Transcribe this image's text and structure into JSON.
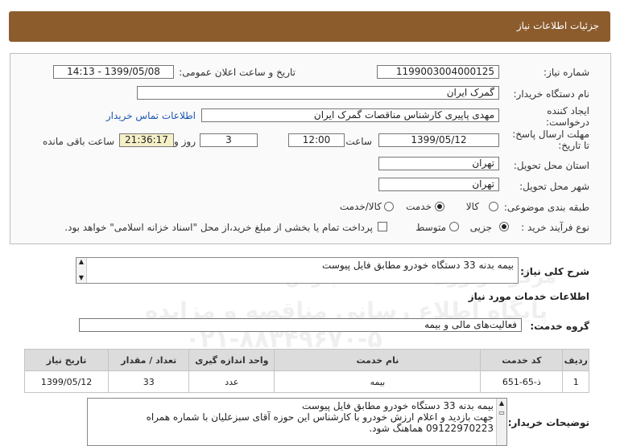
{
  "header": {
    "title": "جزئیات اطلاعات نیاز"
  },
  "fields": {
    "need_number_label": "شماره نیاز:",
    "need_number": "1199003004000125",
    "announce_label": "تاریخ و ساعت اعلان عمومی:",
    "announce_value": "1399/05/08 - 14:13",
    "buyer_org_label": "نام دستگاه خریدار:",
    "buyer_org": "گمرک ایران",
    "creator_label_1": "ایجاد کننده",
    "creator_label_2": "درخواست:",
    "creator": "مهدی پاپیری کارشناس مناقصات گمرک ایران",
    "contact_link": "اطلاعات تماس خریدار",
    "deadline_label_1": "مهلت ارسال پاسخ:",
    "deadline_label_2": "تا تاریخ:",
    "deadline_date": "1399/05/12",
    "time_label": "ساعت",
    "deadline_time": "12:00",
    "days_value": "3",
    "days_label": "روز و",
    "remaining_time": "21:36:17",
    "remaining_label": "ساعت باقی مانده",
    "province_label": "استان محل تحویل:",
    "province": "تهران",
    "city_label": "شهر محل تحویل:",
    "city": "تهران",
    "category_label": "طبقه بندی موضوعی:",
    "category_options": [
      "کالا",
      "خدمت",
      "کالا/خدمت"
    ],
    "category_selected": "خدمت",
    "process_label": "نوع فرآیند خرید :",
    "process_options": [
      "جزیی",
      "متوسط"
    ],
    "process_selected": "جزیی",
    "payment_note": "پرداخت تمام یا بخشی از مبلغ خرید،از محل \"اسناد خزانه اسلامی\" خواهد بود."
  },
  "summary": {
    "label": "شرح کلی نیاز:",
    "text": "بیمه بدنه 33 دستگاه خودرو مطابق فایل پیوست"
  },
  "services": {
    "section_title": "اطلاعات خدمات مورد نیاز",
    "group_label": "گروه خدمت:",
    "group_value": "فعالیت‌های مالی و بیمه",
    "columns": [
      "ردیف",
      "کد خدمت",
      "نام خدمت",
      "واحد اندازه گیری",
      "تعداد / مقدار",
      "تاریخ نیاز"
    ],
    "rows": [
      [
        "1",
        "ذ-65-651",
        "بیمه",
        "عدد",
        "33",
        "1399/05/12"
      ]
    ]
  },
  "buyer_notes": {
    "label": "توضیحات خریدار:",
    "lines": [
      "بیمه بدنه 33 دستگاه خودرو مطابق فایل پیوست",
      "جهت بازدید و اعلام ارزش خودرو با کارشناس این حوزه آقای سبزعلیان با شماره همراه",
      "09122970223 هماهنگ شود."
    ]
  },
  "watermark": {
    "line1": "ParsNamadData",
    "line2": "مرکز فراوری اطلاعات پارس نماد داده ها",
    "line3": "پایگاه اطلاع رسانی مناقصه و مزایده",
    "line4": "۰۲۱-۸۸۳۴۹۶۷۰-۵"
  }
}
